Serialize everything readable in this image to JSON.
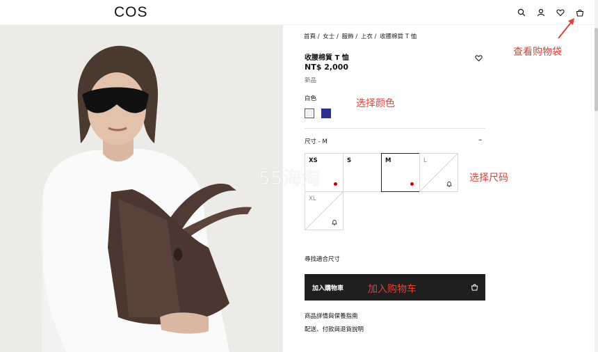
{
  "header": {
    "logo": "COS",
    "icons": [
      "search-icon",
      "account-icon",
      "wishlist-icon",
      "bag-icon"
    ]
  },
  "breadcrumb": [
    "首頁 /",
    "女士 /",
    "服飾 /",
    "上衣 /",
    "收腰棉質 T 恤"
  ],
  "product": {
    "title": "收腰棉質 T 恤",
    "price": "NT$ 2,000",
    "tag": "新品",
    "color_label": "白色",
    "colors": [
      {
        "name": "white",
        "hex": "#ffffff"
      },
      {
        "name": "navy",
        "hex": "#2b2e8c"
      }
    ],
    "size_label": "尺寸 - M",
    "size_toggle": "–",
    "sizes": [
      {
        "label": "XS",
        "available": true,
        "selected": false,
        "low_stock": true
      },
      {
        "label": "S",
        "available": true,
        "selected": false,
        "low_stock": false
      },
      {
        "label": "M",
        "available": true,
        "selected": true,
        "low_stock": true
      },
      {
        "label": "L",
        "available": false,
        "selected": false,
        "notify": true
      },
      {
        "label": "XL",
        "available": false,
        "selected": false,
        "notify": true
      }
    ],
    "find_size": "尋找適合尺寸",
    "add_to_cart": "加入購物車",
    "details_link": "商品詳情與保養指南",
    "shipping_link": "配送、付款與退貨說明"
  },
  "annotations": {
    "view_cart": "查看购物袋",
    "choose_color": "选择颜色",
    "choose_size": "选择尺码",
    "add_to_cart": "加入购物车",
    "watermark": "55海淘"
  },
  "colors": {
    "accent": "#e0403a",
    "button_bg": "#1f1f1f",
    "stock_dot": "#cc0000"
  }
}
